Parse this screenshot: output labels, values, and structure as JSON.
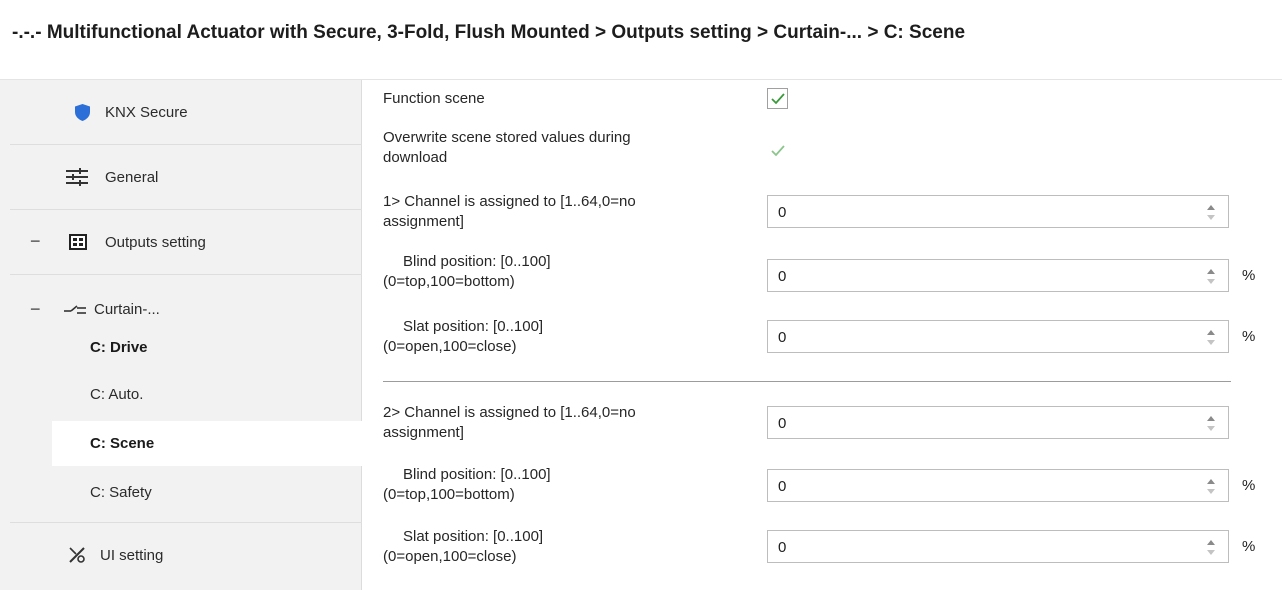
{
  "title": "-.-.- Multifunctional Actuator with Secure, 3-Fold, Flush Mounted > Outputs setting > Curtain-... > C: Scene",
  "sidebar": {
    "knx_secure": "KNX Secure",
    "general": "General",
    "outputs": "Outputs setting",
    "curtain": "Curtain-...",
    "drive": "C: Drive",
    "auto": "C: Auto.",
    "scene": "C: Scene",
    "safety": "C: Safety",
    "ui": "UI setting",
    "collapse_symbol": "−"
  },
  "params": {
    "function_scene": "Function scene",
    "overwrite_line1": "Overwrite scene stored values during",
    "overwrite_line2": "download",
    "ch1_line1": "1> Channel is assigned to [1..64,0=no",
    "ch1_line2": "assignment]",
    "blind1_line1": "Blind position: [0..100]",
    "blind1_line2": "(0=top,100=bottom)",
    "slat1_line1": "Slat position: [0..100]",
    "slat1_line2": "(0=open,100=close)",
    "ch2_line1": "2> Channel is assigned to [1..64,0=no",
    "ch2_line2": "assignment]",
    "blind2_line1": "Blind position: [0..100]",
    "blind2_line2": "(0=top,100=bottom)",
    "slat2_line1": "Slat position: [0..100]",
    "slat2_line2": "(0=open,100=close)"
  },
  "values": {
    "ch1": "0",
    "blind1": "0",
    "slat1": "0",
    "ch2": "0",
    "blind2": "0",
    "slat2": "0"
  },
  "units": {
    "percent": "%"
  },
  "state": {
    "function_scene_checked": true,
    "overwrite_checked": true,
    "overwrite_disabled": true
  },
  "icons": {
    "knx_secure": "shield-icon",
    "general": "sliders-icon",
    "outputs": "grid-icon",
    "curtain": "curtain-switch-icon",
    "ui": "ui-setting-icon",
    "check": "check-icon"
  },
  "colors": {
    "shield": "#2d6fd8",
    "check_active": "#3a9a3a",
    "check_disabled": "#8cc58c"
  }
}
